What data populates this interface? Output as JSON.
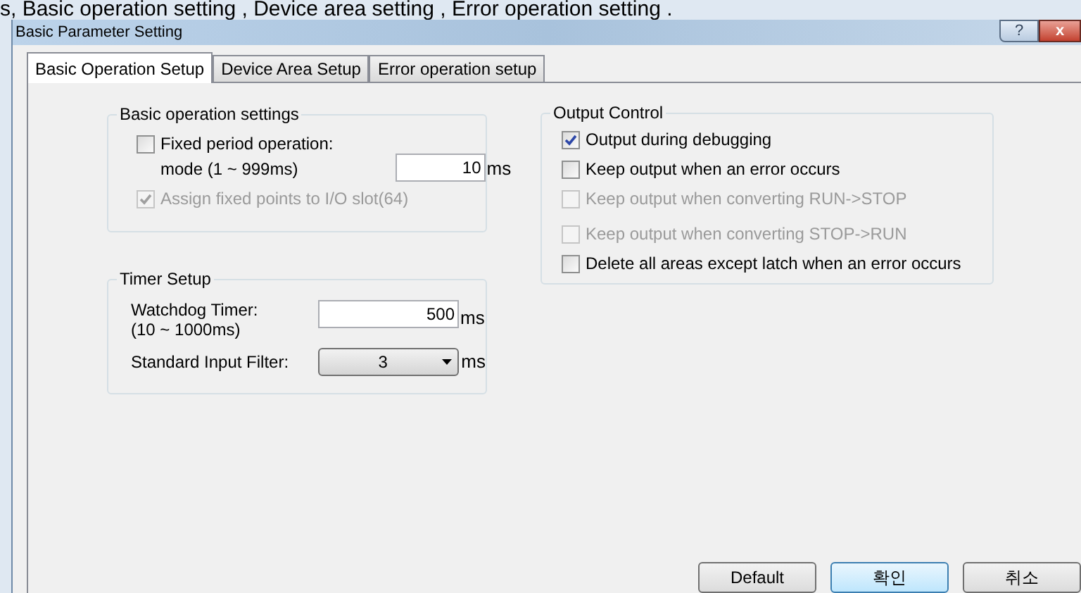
{
  "caption": "s, Basic operation setting , Device area setting , Error operation setting .",
  "window": {
    "title": "Basic Parameter Setting",
    "controls": [
      "?",
      "x"
    ]
  },
  "tabs": [
    {
      "label": "Basic Operation Setup",
      "selected": true
    },
    {
      "label": "Device Area Setup",
      "selected": false
    },
    {
      "label": "Error operation setup",
      "selected": false
    }
  ],
  "basic_operation": {
    "title": "Basic operation settings",
    "fixed_period": {
      "label": "Fixed period operation:",
      "sublabel": "mode (1 ~ 999ms)",
      "checked": false,
      "disabled": false,
      "value": "10",
      "unit": "ms"
    },
    "assign_fixed": {
      "label": "Assign fixed points to I/O slot(64)",
      "checked": true,
      "disabled": true
    }
  },
  "timer_setup": {
    "title": "Timer Setup",
    "watchdog": {
      "label": "Watchdog Timer:",
      "sublabel": "(10 ~ 1000ms)",
      "value": "500",
      "unit": "ms"
    },
    "input_filter": {
      "label": "Standard Input Filter:",
      "value": "3",
      "unit": "ms"
    }
  },
  "output_control": {
    "title": "Output Control",
    "options": [
      {
        "label": "Output during debugging",
        "checked": true,
        "disabled": false
      },
      {
        "label": "Keep output when an error occurs",
        "checked": false,
        "disabled": false
      },
      {
        "label": "Keep output when converting RUN->STOP",
        "checked": false,
        "disabled": true
      },
      {
        "label": "Keep output when converting STOP->RUN",
        "checked": false,
        "disabled": true
      },
      {
        "label": "Delete all areas except latch when an error occurs",
        "checked": false,
        "disabled": false
      }
    ]
  },
  "buttons": [
    {
      "label": "Default",
      "selected": false
    },
    {
      "label": "확인",
      "selected": true
    },
    {
      "label": "취소",
      "selected": false
    }
  ]
}
